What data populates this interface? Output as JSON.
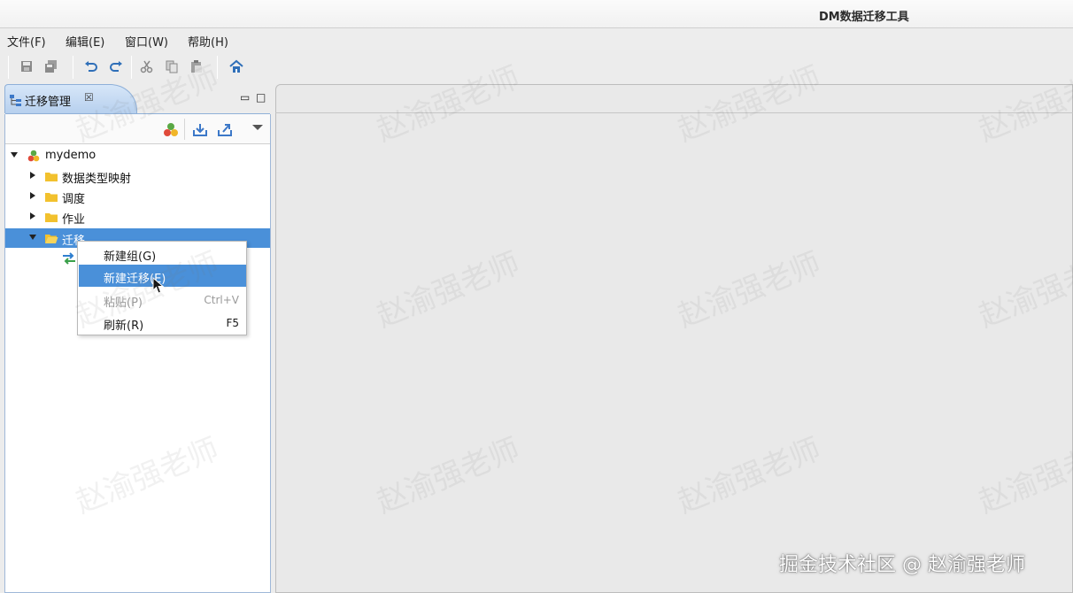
{
  "window": {
    "title": "DM数据迁移工具"
  },
  "menubar": {
    "items": [
      "文件(F)",
      "编辑(E)",
      "窗口(W)",
      "帮助(H)"
    ]
  },
  "toolbar": {
    "icons": [
      "save-icon",
      "save-all-icon",
      "undo-icon",
      "redo-icon",
      "cut-icon",
      "copy-icon",
      "paste-icon",
      "home-icon"
    ]
  },
  "panel": {
    "tab_label": "迁移管理",
    "close_glyph": "☒",
    "minimize_glyph": "▭",
    "maximize_glyph": "□"
  },
  "tree": {
    "root": "mydemo",
    "children": [
      {
        "label": "数据类型映射"
      },
      {
        "label": "调度"
      },
      {
        "label": "作业"
      },
      {
        "label": "迁移"
      }
    ]
  },
  "context_menu": {
    "items": [
      {
        "label": "新建组(G)",
        "shortcut": ""
      },
      {
        "label": "新建迁移(E)",
        "shortcut": ""
      },
      {
        "label": "粘贴(P)",
        "shortcut": "Ctrl+V"
      },
      {
        "label": "刷新(R)",
        "shortcut": "F5"
      }
    ]
  },
  "watermark": {
    "text": "赵渝强老师"
  },
  "footer_watermark": "掘金技术社区 @ 赵渝强老师",
  "colors": {
    "selection": "#4a90d9",
    "tab_blue": "#b7d0ee",
    "folder": "#f2c12e"
  }
}
